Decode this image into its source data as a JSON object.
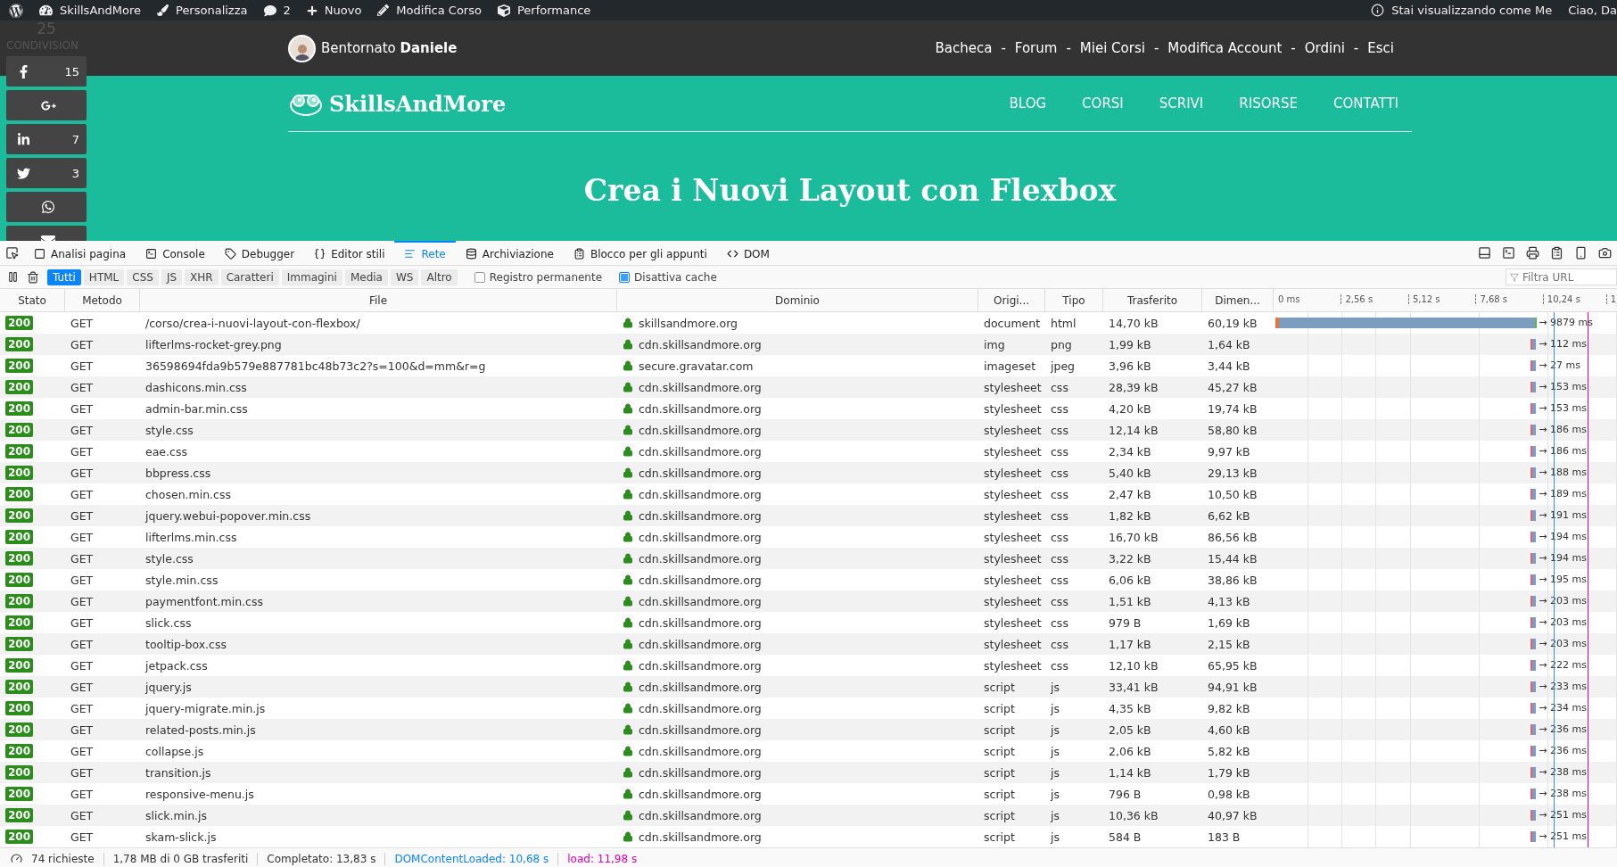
{
  "admin_bar": {
    "items": [
      {
        "kind": "wordpress"
      },
      {
        "kind": "dashboard",
        "label": "SkillsAndMore"
      },
      {
        "kind": "brush",
        "label": "Personalizza"
      },
      {
        "kind": "comments",
        "label": "2"
      },
      {
        "kind": "plus",
        "label": "Nuovo"
      },
      {
        "kind": "pencil",
        "label": "Modifica Corso"
      },
      {
        "kind": "performance",
        "label": "Performance"
      }
    ],
    "right": [
      {
        "kind": "viewer",
        "label": "Stai visualizzando come Me"
      },
      {
        "kind": "text",
        "label": "Ciao, Da"
      }
    ]
  },
  "share": {
    "count": "25",
    "label": "CONDIVISION",
    "buttons": [
      {
        "kind": "facebook",
        "count": "15"
      },
      {
        "kind": "googleplus"
      },
      {
        "kind": "linkedin",
        "count": "7"
      },
      {
        "kind": "twitter",
        "count": "3"
      },
      {
        "kind": "whatsapp"
      },
      {
        "kind": "email"
      }
    ]
  },
  "site_header": {
    "greeting": "Bentornato **Daniele**",
    "links": [
      {
        "label": "Bacheca",
        "separator": "-"
      },
      {
        "label": "Forum",
        "separator": "-"
      },
      {
        "label": "Miei Corsi",
        "separator": "-"
      },
      {
        "label": "Modifica Account",
        "separator": "-"
      },
      {
        "label": "Ordini",
        "separator": "-"
      },
      {
        "label": "Esci"
      }
    ]
  },
  "hero": {
    "logo": "SkillsAndMore",
    "nav": [
      "BLOG",
      "CORSI",
      "SCRIVI",
      "RISORSE",
      "CONTATTI"
    ],
    "title": "Crea i Nuovi Layout con Flexbox"
  },
  "devtools": {
    "tabs": [
      {
        "kind": "inspector",
        "label": "Analisi pagina",
        "selected": false
      },
      {
        "kind": "console",
        "label": "Console",
        "selected": false
      },
      {
        "kind": "debugger",
        "label": "Debugger",
        "selected": false
      },
      {
        "kind": "style",
        "label": "Editor stili",
        "selected": false
      },
      {
        "kind": "network",
        "label": "Rete",
        "selected": true
      },
      {
        "kind": "storage",
        "label": "Archiviazione",
        "selected": false
      },
      {
        "kind": "scratchpad",
        "label": "Blocco per gli appunti",
        "selected": false
      },
      {
        "kind": "dom",
        "label": "DOM",
        "selected": false
      }
    ],
    "filters": [
      {
        "label": "Tutti",
        "selected": true
      },
      {
        "label": "HTML",
        "selected": false
      },
      {
        "label": "CSS",
        "selected": false
      },
      {
        "label": "JS",
        "selected": false
      },
      {
        "label": "XHR",
        "selected": false
      },
      {
        "label": "Caratteri",
        "selected": false
      },
      {
        "label": "Immagini",
        "selected": false
      },
      {
        "label": "Media",
        "selected": false
      },
      {
        "label": "WS",
        "selected": false
      },
      {
        "label": "Altro",
        "selected": false
      }
    ],
    "options": [
      {
        "label": "Registro permanente",
        "checked": false
      },
      {
        "label": "Disattiva cache",
        "checked": true
      }
    ],
    "url_filter": {
      "placeholder": "Filtra URL"
    },
    "columns": [
      "Stato",
      "Metodo",
      "File",
      "Dominio",
      "Origi...",
      "Tipo",
      "Trasferito",
      "Dimen..."
    ],
    "timeline_ticks": [
      "0 ms",
      "2,56 s",
      "5,12 s",
      "7,68 s",
      "10,24 s",
      "1"
    ],
    "rows": [
      {
        "status": "200",
        "method": "GET",
        "file": "/corso/crea-i-nuovi-layout-con-flexbox/",
        "domain": "skillsandmore.org",
        "cause": "document",
        "type": "html",
        "transferred": "14,70 kB",
        "size": "60,19 kB",
        "timing": "→ 9879 ms"
      },
      {
        "status": "200",
        "method": "GET",
        "file": "lifterlms-rocket-grey.png",
        "domain": "cdn.skillsandmore.org",
        "cause": "img",
        "type": "png",
        "transferred": "1,99 kB",
        "size": "1,64 kB",
        "timing": "→ 112 ms"
      },
      {
        "status": "200",
        "method": "GET",
        "file": "36598694fda9b579e887781bc48b73c2?s=100&d=mm&r=g",
        "domain": "secure.gravatar.com",
        "cause": "imageset",
        "type": "jpeg",
        "transferred": "3,96 kB",
        "size": "3,44 kB",
        "timing": "→ 27 ms"
      },
      {
        "status": "200",
        "method": "GET",
        "file": "dashicons.min.css",
        "domain": "cdn.skillsandmore.org",
        "cause": "stylesheet",
        "type": "css",
        "transferred": "28,39 kB",
        "size": "45,27 kB",
        "timing": "→ 153 ms"
      },
      {
        "status": "200",
        "method": "GET",
        "file": "admin-bar.min.css",
        "domain": "cdn.skillsandmore.org",
        "cause": "stylesheet",
        "type": "css",
        "transferred": "4,20 kB",
        "size": "19,74 kB",
        "timing": "→ 153 ms"
      },
      {
        "status": "200",
        "method": "GET",
        "file": "style.css",
        "domain": "cdn.skillsandmore.org",
        "cause": "stylesheet",
        "type": "css",
        "transferred": "12,14 kB",
        "size": "58,80 kB",
        "timing": "→ 186 ms"
      },
      {
        "status": "200",
        "method": "GET",
        "file": "eae.css",
        "domain": "cdn.skillsandmore.org",
        "cause": "stylesheet",
        "type": "css",
        "transferred": "2,34 kB",
        "size": "9,97 kB",
        "timing": "→ 186 ms"
      },
      {
        "status": "200",
        "method": "GET",
        "file": "bbpress.css",
        "domain": "cdn.skillsandmore.org",
        "cause": "stylesheet",
        "type": "css",
        "transferred": "5,40 kB",
        "size": "29,13 kB",
        "timing": "→ 188 ms"
      },
      {
        "status": "200",
        "method": "GET",
        "file": "chosen.min.css",
        "domain": "cdn.skillsandmore.org",
        "cause": "stylesheet",
        "type": "css",
        "transferred": "2,47 kB",
        "size": "10,50 kB",
        "timing": "→ 189 ms"
      },
      {
        "status": "200",
        "method": "GET",
        "file": "jquery.webui-popover.min.css",
        "domain": "cdn.skillsandmore.org",
        "cause": "stylesheet",
        "type": "css",
        "transferred": "1,82 kB",
        "size": "6,62 kB",
        "timing": "→ 191 ms"
      },
      {
        "status": "200",
        "method": "GET",
        "file": "lifterlms.min.css",
        "domain": "cdn.skillsandmore.org",
        "cause": "stylesheet",
        "type": "css",
        "transferred": "16,70 kB",
        "size": "86,56 kB",
        "timing": "→ 194 ms"
      },
      {
        "status": "200",
        "method": "GET",
        "file": "style.css",
        "domain": "cdn.skillsandmore.org",
        "cause": "stylesheet",
        "type": "css",
        "transferred": "3,22 kB",
        "size": "15,44 kB",
        "timing": "→ 194 ms"
      },
      {
        "status": "200",
        "method": "GET",
        "file": "style.min.css",
        "domain": "cdn.skillsandmore.org",
        "cause": "stylesheet",
        "type": "css",
        "transferred": "6,06 kB",
        "size": "38,86 kB",
        "timing": "→ 195 ms"
      },
      {
        "status": "200",
        "method": "GET",
        "file": "paymentfont.min.css",
        "domain": "cdn.skillsandmore.org",
        "cause": "stylesheet",
        "type": "css",
        "transferred": "1,51 kB",
        "size": "4,13 kB",
        "timing": "→ 203 ms"
      },
      {
        "status": "200",
        "method": "GET",
        "file": "slick.css",
        "domain": "cdn.skillsandmore.org",
        "cause": "stylesheet",
        "type": "css",
        "transferred": "979 B",
        "size": "1,69 kB",
        "timing": "→ 203 ms"
      },
      {
        "status": "200",
        "method": "GET",
        "file": "tooltip-box.css",
        "domain": "cdn.skillsandmore.org",
        "cause": "stylesheet",
        "type": "css",
        "transferred": "1,17 kB",
        "size": "2,15 kB",
        "timing": "→ 203 ms"
      },
      {
        "status": "200",
        "method": "GET",
        "file": "jetpack.css",
        "domain": "cdn.skillsandmore.org",
        "cause": "stylesheet",
        "type": "css",
        "transferred": "12,10 kB",
        "size": "65,95 kB",
        "timing": "→ 222 ms"
      },
      {
        "status": "200",
        "method": "GET",
        "file": "jquery.js",
        "domain": "cdn.skillsandmore.org",
        "cause": "script",
        "type": "js",
        "transferred": "33,41 kB",
        "size": "94,91 kB",
        "timing": "→ 233 ms"
      },
      {
        "status": "200",
        "method": "GET",
        "file": "jquery-migrate.min.js",
        "domain": "cdn.skillsandmore.org",
        "cause": "script",
        "type": "js",
        "transferred": "4,35 kB",
        "size": "9,82 kB",
        "timing": "→ 234 ms"
      },
      {
        "status": "200",
        "method": "GET",
        "file": "related-posts.min.js",
        "domain": "cdn.skillsandmore.org",
        "cause": "script",
        "type": "js",
        "transferred": "2,05 kB",
        "size": "4,60 kB",
        "timing": "→ 236 ms"
      },
      {
        "status": "200",
        "method": "GET",
        "file": "collapse.js",
        "domain": "cdn.skillsandmore.org",
        "cause": "script",
        "type": "js",
        "transferred": "2,06 kB",
        "size": "5,82 kB",
        "timing": "→ 236 ms"
      },
      {
        "status": "200",
        "method": "GET",
        "file": "transition.js",
        "domain": "cdn.skillsandmore.org",
        "cause": "script",
        "type": "js",
        "transferred": "1,14 kB",
        "size": "1,79 kB",
        "timing": "→ 238 ms"
      },
      {
        "status": "200",
        "method": "GET",
        "file": "responsive-menu.js",
        "domain": "cdn.skillsandmore.org",
        "cause": "script",
        "type": "js",
        "transferred": "796 B",
        "size": "0,98 kB",
        "timing": "→ 238 ms"
      },
      {
        "status": "200",
        "method": "GET",
        "file": "slick.min.js",
        "domain": "cdn.skillsandmore.org",
        "cause": "script",
        "type": "js",
        "transferred": "10,36 kB",
        "size": "40,97 kB",
        "timing": "→ 251 ms"
      },
      {
        "status": "200",
        "method": "GET",
        "file": "skam-slick.js",
        "domain": "cdn.skillsandmore.org",
        "cause": "script",
        "type": "js",
        "transferred": "584 B",
        "size": "183 B",
        "timing": "→ 251 ms"
      }
    ],
    "status_bar": [
      {
        "kind": "plain",
        "label": "74 richieste"
      },
      {
        "kind": "plain",
        "label": "1,78 MB di 0 GB trasferiti"
      },
      {
        "kind": "plain",
        "label": "Completato: 13,83 s"
      },
      {
        "kind": "dom",
        "label": "DOMContentLoaded: 10,68 s"
      },
      {
        "kind": "load",
        "label": "load: 11,98 s"
      }
    ]
  }
}
